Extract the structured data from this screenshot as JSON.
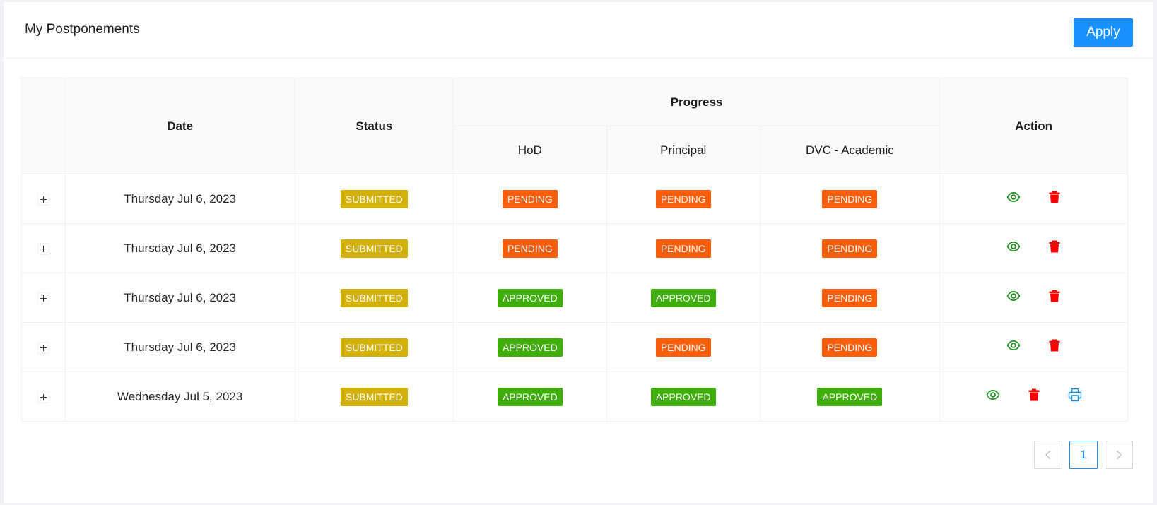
{
  "header": {
    "title": "My Postponements",
    "apply_label": "Apply"
  },
  "table": {
    "columns": {
      "date": "Date",
      "status": "Status",
      "progress": "Progress",
      "hod": "HoD",
      "principal": "Principal",
      "dvc": "DVC - Academic",
      "action": "Action"
    },
    "rows": [
      {
        "date": "Thursday Jul 6, 2023",
        "status": "SUBMITTED",
        "hod": "PENDING",
        "principal": "PENDING",
        "dvc": "PENDING",
        "printable": false
      },
      {
        "date": "Thursday Jul 6, 2023",
        "status": "SUBMITTED",
        "hod": "PENDING",
        "principal": "PENDING",
        "dvc": "PENDING",
        "printable": false
      },
      {
        "date": "Thursday Jul 6, 2023",
        "status": "SUBMITTED",
        "hod": "APPROVED",
        "principal": "APPROVED",
        "dvc": "PENDING",
        "printable": false
      },
      {
        "date": "Thursday Jul 6, 2023",
        "status": "SUBMITTED",
        "hod": "APPROVED",
        "principal": "PENDING",
        "dvc": "PENDING",
        "printable": false
      },
      {
        "date": "Wednesday Jul 5, 2023",
        "status": "SUBMITTED",
        "hod": "APPROVED",
        "principal": "APPROVED",
        "dvc": "APPROVED",
        "printable": true
      }
    ]
  },
  "icons": {
    "view": "eye-icon",
    "delete": "trash-icon",
    "print": "printer-icon",
    "expand": "plus-icon"
  },
  "colors": {
    "primary": "#1890ff",
    "submitted": "#d4b106",
    "pending": "#fa5e0a",
    "approved": "#3fad0a",
    "view": "#138d13",
    "delete": "#ff0000",
    "print": "#1890d8"
  },
  "pagination": {
    "current": "1",
    "prev": "<",
    "next": ">"
  }
}
